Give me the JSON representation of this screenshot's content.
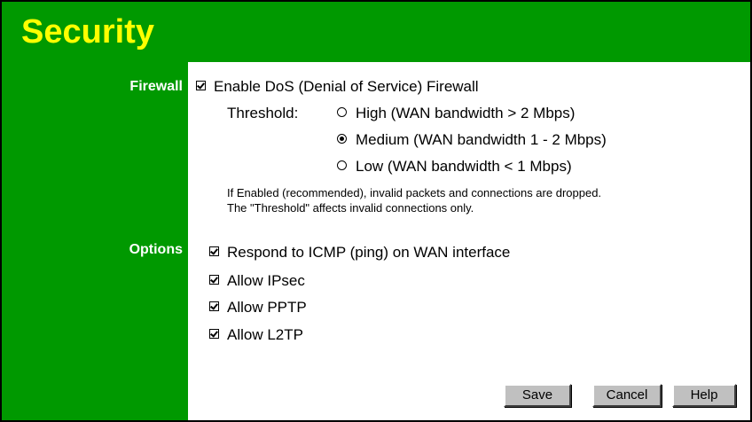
{
  "page": {
    "title": "Security"
  },
  "firewall": {
    "section_label": "Firewall",
    "enable_dos": {
      "label": "Enable DoS (Denial of Service) Firewall",
      "checked": true
    },
    "threshold_label": "Threshold:",
    "thresholds": [
      {
        "label": "High (WAN bandwidth > 2 Mbps)",
        "selected": false
      },
      {
        "label": "Medium (WAN bandwidth 1 - 2 Mbps)",
        "selected": true
      },
      {
        "label": "Low (WAN bandwidth < 1 Mbps)",
        "selected": false
      }
    ],
    "note_line1": "If Enabled (recommended), invalid packets and connections are dropped.",
    "note_line2": "The \"Threshold\" affects invalid connections only."
  },
  "options": {
    "section_label": "Options",
    "items": [
      {
        "label": "Respond to ICMP (ping) on WAN interface",
        "checked": true
      },
      {
        "label": "Allow IPsec",
        "checked": true
      },
      {
        "label": "Allow PPTP",
        "checked": true
      },
      {
        "label": "Allow L2TP",
        "checked": true
      }
    ]
  },
  "buttons": {
    "save": "Save",
    "cancel": "Cancel",
    "help": "Help"
  },
  "colors": {
    "header_bg": "#009900",
    "title_text": "#ffff00",
    "label_text": "#ffffff"
  }
}
